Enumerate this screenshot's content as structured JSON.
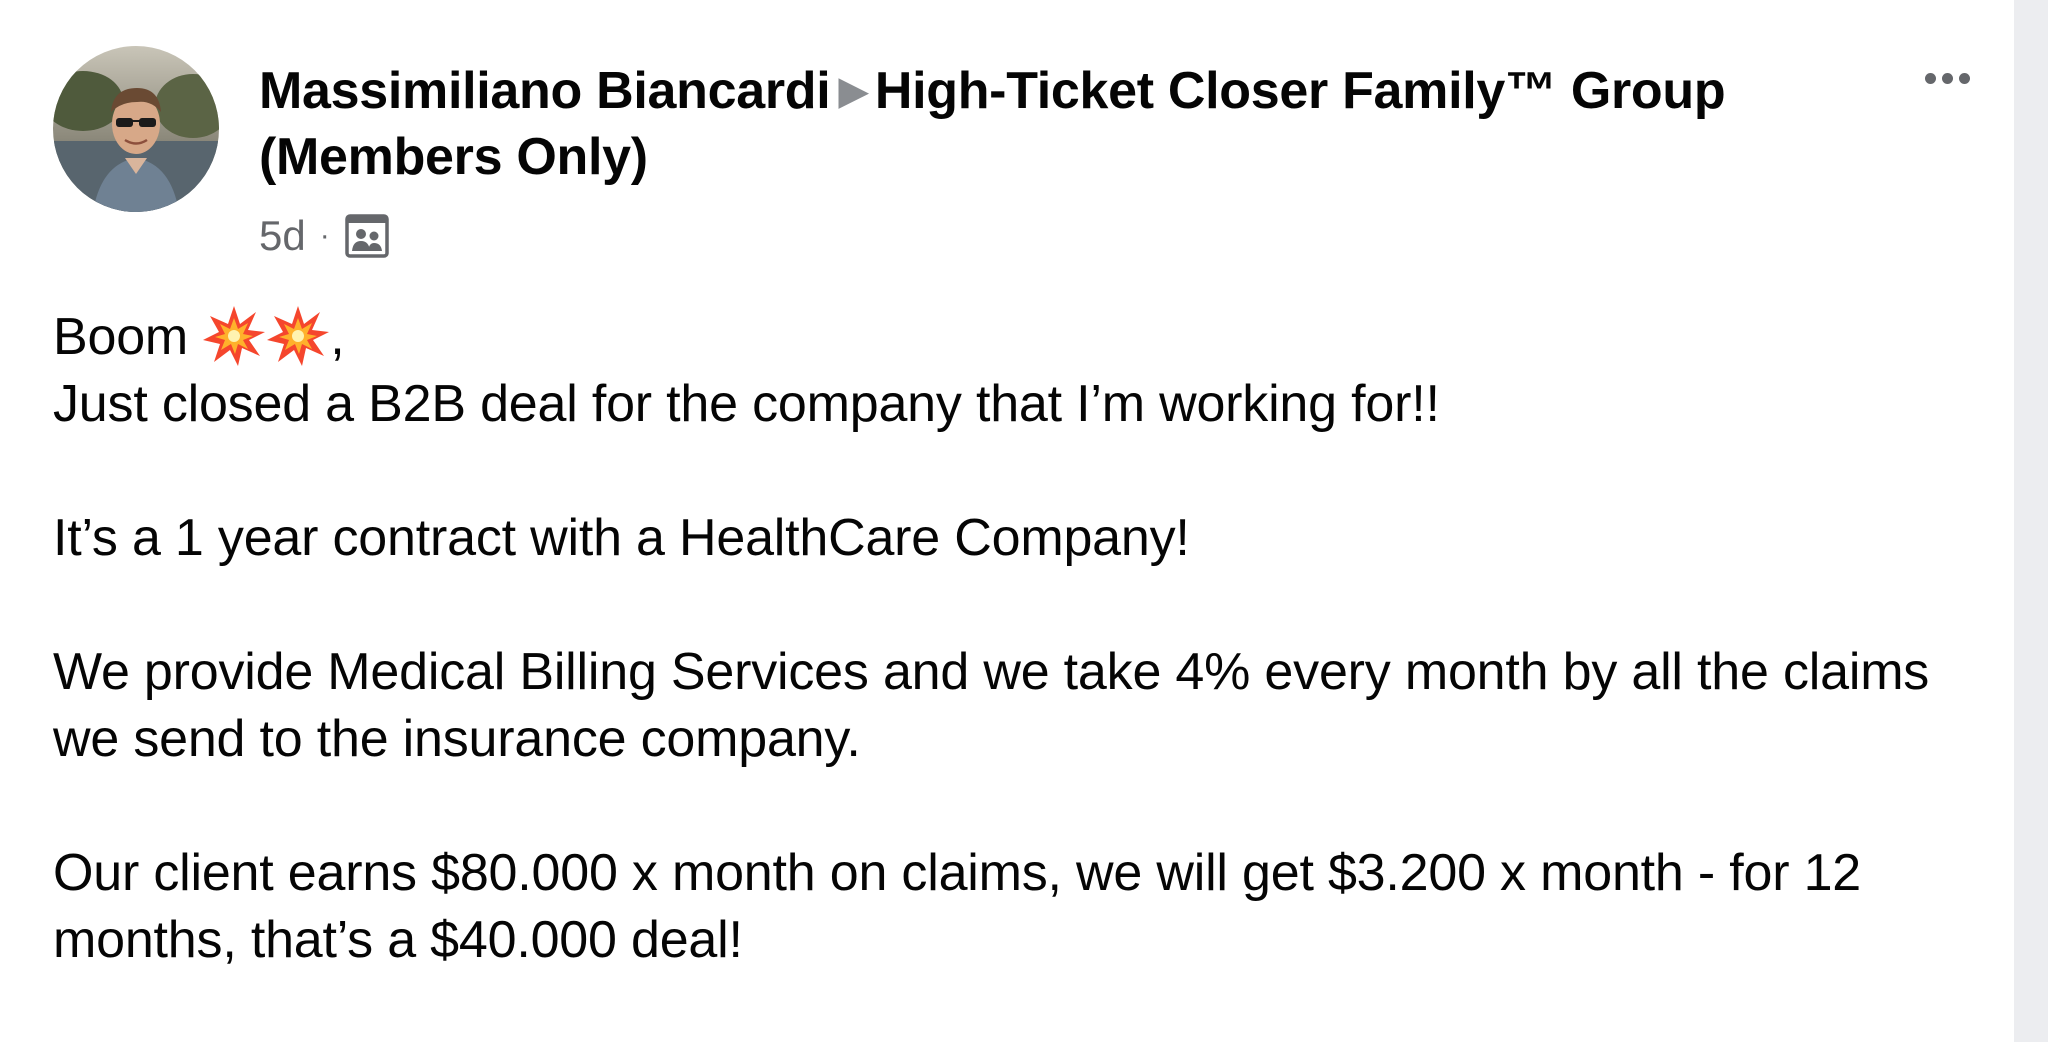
{
  "post": {
    "author": "Massimiliano Biancardi",
    "group": "High-Ticket Closer Family™ Group (Members Only)",
    "separator_icon": "right-triangle-icon",
    "timestamp": "5d",
    "meta_separator": "·",
    "audience_icon": "group-members-icon",
    "more_icon": "ellipsis-icon"
  },
  "content": {
    "line1_text": "Boom",
    "line1_emojis": [
      "collision-emoji-icon",
      "collision-emoji-icon"
    ],
    "line1_suffix": ",",
    "line2": "Just closed a B2B deal for the company that I’m working for!!",
    "paragraph2": "It’s a 1 year contract with a HealthCare Company!",
    "paragraph3": "We provide Medical Billing Services and we take 4% every month by all the claims we send to the insurance company.",
    "paragraph4": "Our client earns $80.000 x month on claims, we will get $3.200 x month - for 12 months, that’s a $40.000 deal!"
  },
  "colors": {
    "text_primary": "#050505",
    "text_secondary": "#65676b",
    "arrow": "#8a8d91",
    "side_strip": "#ecedf0"
  }
}
